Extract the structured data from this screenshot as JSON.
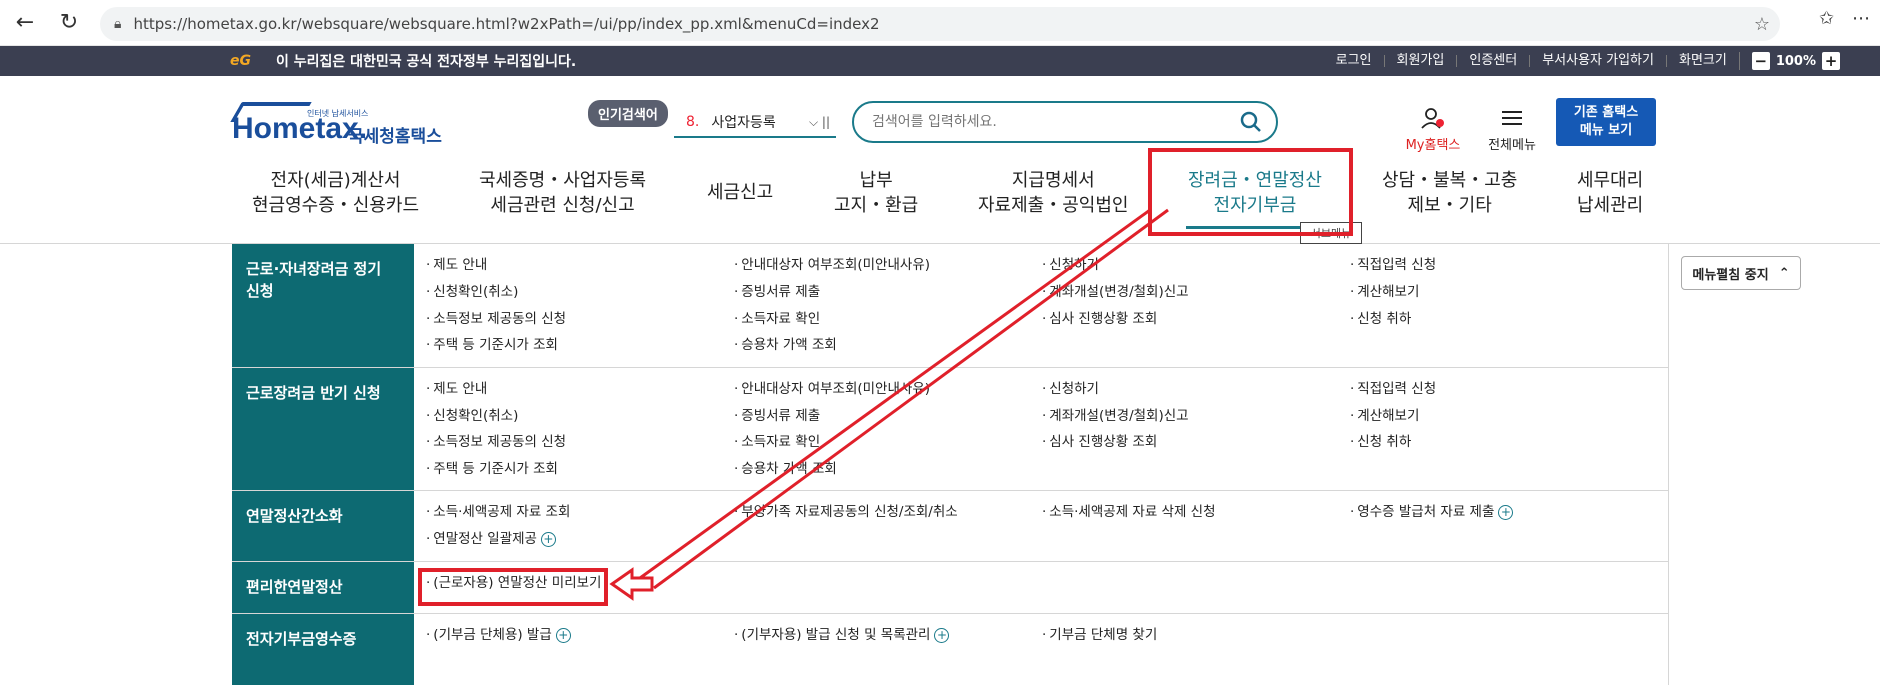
{
  "browser": {
    "url": "https://hometax.go.kr/websquare/websquare.html?w2xPath=/ui/pp/index_pp.xml&menuCd=index2"
  },
  "gov_banner": {
    "logo": "eG",
    "text": "이 누리집은 대한민국 공식 전자정부 누리집입니다.",
    "links": [
      "로그인",
      "회원가입",
      "인증센터",
      "부서사용자 가입하기",
      "화면크기"
    ],
    "zoom": "100%",
    "zoom_minus": "−",
    "zoom_plus": "+"
  },
  "header": {
    "logo_main": "Hometax.",
    "logo_sub": "인터넷 납세서비스",
    "logo_ko": "국세청홈택스",
    "popular_label": "인기검색어",
    "popular_rank": "8.",
    "popular_term": "사업자등록",
    "search_placeholder": "검색어를 입력하세요.",
    "my_hometax": "My홈택스",
    "all_menu": "전체메뉴",
    "old_line1": "기존 홈택스",
    "old_line2": "메뉴 보기",
    "tooltip": "서브메뉴"
  },
  "gnb": [
    {
      "l1": "전자(세금)계산서",
      "l2": "현금영수증・신용카드"
    },
    {
      "l1": "국세증명・사업자등록",
      "l2": "세금관련 신청/신고"
    },
    {
      "l1": "세금신고",
      "l2": ""
    },
    {
      "l1": "납부",
      "l2": "고지・환급"
    },
    {
      "l1": "지급명세서",
      "l2": "자료제출・공익법인"
    },
    {
      "l1": "장려금・연말정산",
      "l2": "전자기부금"
    },
    {
      "l1": "상담・불복・고충",
      "l2": "제보・기타"
    },
    {
      "l1": "세무대리",
      "l2": "납세관리"
    }
  ],
  "menu_stop": "메뉴펼침 중지",
  "sections": [
    {
      "title": "근로·자녀장려금 정기 신청",
      "items": [
        "제도 안내",
        "안내대상자 여부조회(미안내사유)",
        "신청하기",
        "직접입력 신청",
        "신청확인(취소)",
        "증빙서류 제출",
        "계좌개설(변경/철회)신고",
        "계산해보기",
        "소득정보 제공동의 신청",
        "소득자료 확인",
        "심사 진행상황 조회",
        "신청 취하",
        "주택 등 기준시가 조회",
        "승용차 가액 조회"
      ]
    },
    {
      "title": "근로장려금 반기 신청",
      "items": [
        "제도 안내",
        "안내대상자 여부조회(미안내사유)",
        "신청하기",
        "직접입력 신청",
        "신청확인(취소)",
        "증빙서류 제출",
        "계좌개설(변경/철회)신고",
        "계산해보기",
        "소득정보 제공동의 신청",
        "소득자료 확인",
        "심사 진행상황 조회",
        "신청 취하",
        "주택 등 기준시가 조회",
        "승용차 가액 조회"
      ]
    },
    {
      "title": "연말정산간소화",
      "items": [
        "소득·세액공제 자료 조회",
        "부양가족 자료제공동의 신청/조회/취소",
        "소득·세액공제 자료 삭제 신청",
        "영수증 발급처 자료 제출",
        "연말정산 일괄제공"
      ]
    },
    {
      "title": "편리한연말정산",
      "items": [
        "(근로자용) 연말정산 미리보기"
      ]
    },
    {
      "title": "전자기부금영수증",
      "items": [
        "(기부금 단체용) 발급",
        "(기부자용) 발급 신청 및 목록관리",
        "기부금 단체명 찾기"
      ]
    }
  ],
  "colors": {
    "teal": "#0d6a72",
    "annotation": "#e0202a",
    "accent": "#1a7a8a"
  }
}
